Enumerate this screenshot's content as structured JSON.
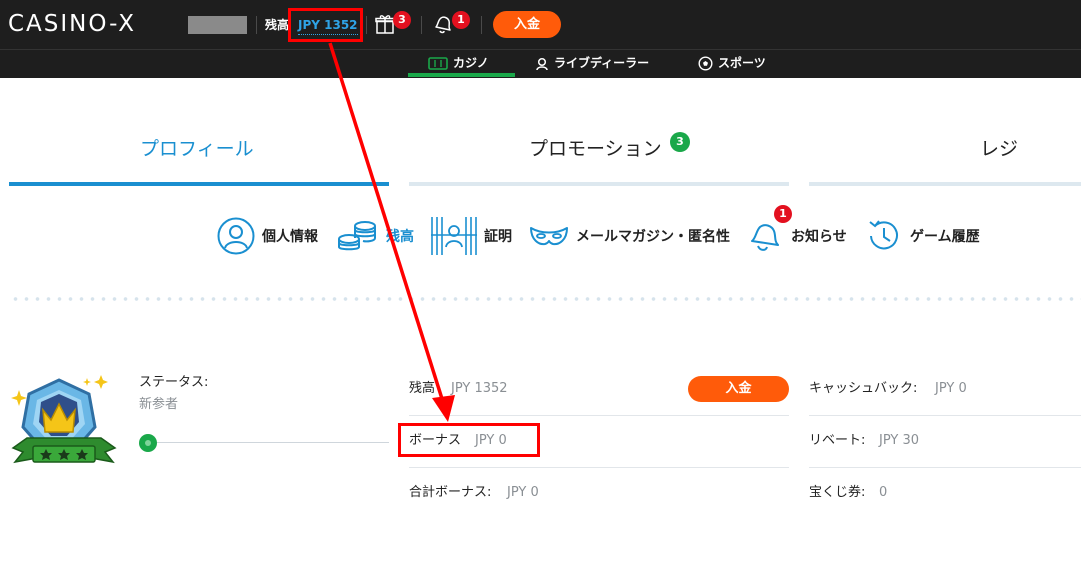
{
  "header": {
    "logo": "CASINO-X",
    "balance_label": "残高",
    "balance_value": "JPY 1352",
    "gifts_count": "3",
    "notifications_count": "1",
    "deposit_label": "入金"
  },
  "nav": {
    "items": [
      {
        "label": "カジノ",
        "active": true
      },
      {
        "label": "ライブディーラー"
      },
      {
        "label": "スポーツ"
      }
    ],
    "active_color": "#1aa84a"
  },
  "tabs": [
    {
      "label": "プロフィール",
      "active": true
    },
    {
      "label": "プロモーション",
      "badge": "3"
    },
    {
      "label": "レジ"
    }
  ],
  "subnav": {
    "items": [
      {
        "label": "個人情報"
      },
      {
        "label": "残高"
      },
      {
        "label": "証明"
      },
      {
        "label": "メールマガジン・匿名性"
      },
      {
        "label": "お知らせ",
        "badge": "1"
      },
      {
        "label": "ゲーム履歴"
      }
    ]
  },
  "profile": {
    "status_label": "ステータス:",
    "status_value": "新参者",
    "progress": 0
  },
  "details": {
    "balance_label": "残高",
    "balance_value": "JPY 1352",
    "deposit_label": "入金",
    "bonus_label": "ボーナス",
    "bonus_value": "JPY 0",
    "total_bonus_label": "合計ボーナス:",
    "total_bonus_value": "JPY 0",
    "cashback_label": "キャッシュバック:",
    "cashback_value": "JPY 0",
    "rebate_label": "リベート:",
    "rebate_value": "JPY 30",
    "lottery_label": "宝くじ券:",
    "lottery_value": "0"
  },
  "colors": {
    "accent_blue": "#1a8fd0",
    "deposit_orange": "#ff5b0a",
    "badge_red": "#e3101f",
    "badge_green": "#1aa84a",
    "highlight_red": "#ff0000"
  }
}
